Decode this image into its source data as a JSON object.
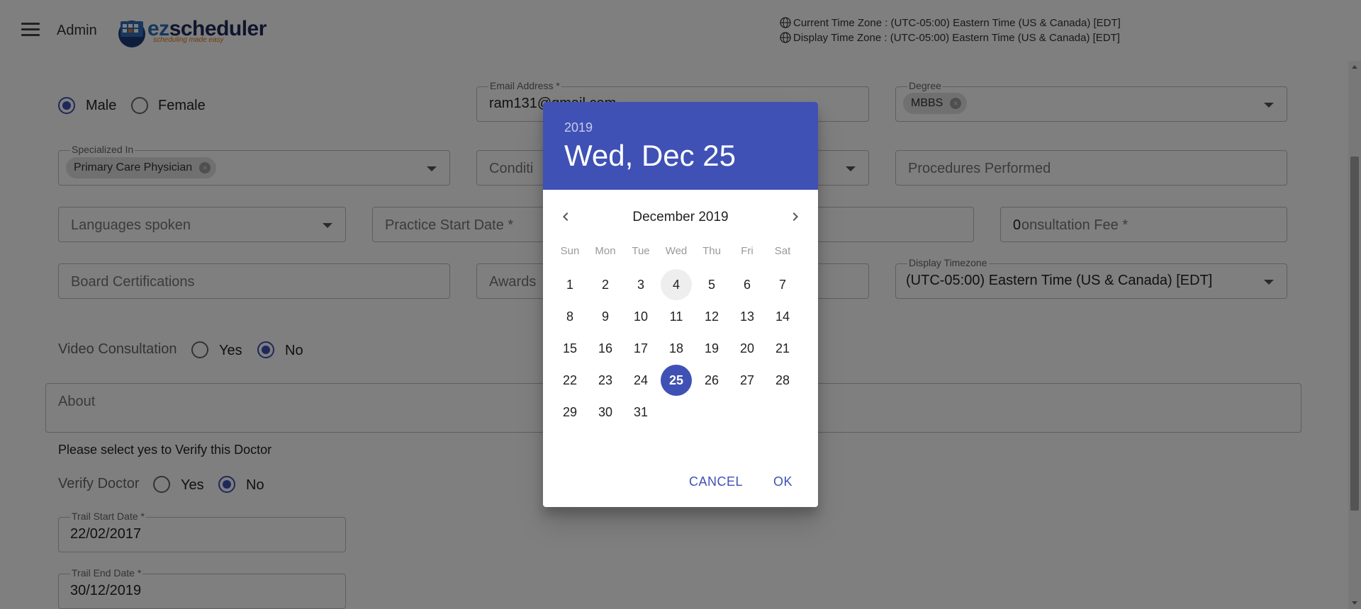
{
  "header": {
    "admin_label": "Admin",
    "logo_text_ez": "ez",
    "logo_text_rest": "scheduler",
    "logo_tagline": "scheduling made easy",
    "current_tz": "Current Time Zone : (UTC-05:00) Eastern Time (US & Canada) [EDT]",
    "display_tz": "Display Time Zone : (UTC-05:00) Eastern Time (US & Canada) [EDT]"
  },
  "form": {
    "gender": {
      "male": "Male",
      "female": "Female",
      "selected": "Male"
    },
    "email": {
      "label": "Email Address *",
      "value": "ram131@gmail.com"
    },
    "degree": {
      "label": "Degree",
      "chip": "MBBS"
    },
    "specialized": {
      "label": "Specialized In",
      "chip": "Primary Care Physician"
    },
    "conditions": {
      "placeholder": "Conditi"
    },
    "procedures": {
      "placeholder": "Procedures Performed"
    },
    "languages": {
      "placeholder": "Languages spoken"
    },
    "practice_start": {
      "placeholder": "Practice Start Date *"
    },
    "consultation_fee": {
      "value": "0",
      "placeholder": "onsultation Fee  *"
    },
    "board_cert": {
      "placeholder": "Board Certifications"
    },
    "awards": {
      "placeholder": "Awards"
    },
    "display_timezone": {
      "label": "Display Timezone",
      "value": "(UTC-05:00) Eastern Time (US & Canada) [EDT]"
    },
    "video_consultation": {
      "label": "Video Consultation",
      "yes": "Yes",
      "no": "No",
      "selected": "No"
    },
    "about": {
      "placeholder": "About"
    },
    "verify_note": "Please select yes to Verify this Doctor",
    "verify_doctor": {
      "label": "Verify Doctor",
      "yes": "Yes",
      "no": "No",
      "selected": "No"
    },
    "trail_start": {
      "label": "Trail Start Date *",
      "value": "22/02/2017"
    },
    "trail_end": {
      "label": "Trail End Date *",
      "value": "30/12/2019"
    }
  },
  "datepicker": {
    "year": "2019",
    "selected_display": "Wed, Dec 25",
    "month_label": "December 2019",
    "weekdays": [
      "Sun",
      "Mon",
      "Tue",
      "Wed",
      "Thu",
      "Fri",
      "Sat"
    ],
    "first_weekday_index": 0,
    "days_in_month": 31,
    "today": 4,
    "selected_day": 25,
    "cancel_label": "CANCEL",
    "ok_label": "OK"
  },
  "colors": {
    "primary": "#3f51b5"
  }
}
